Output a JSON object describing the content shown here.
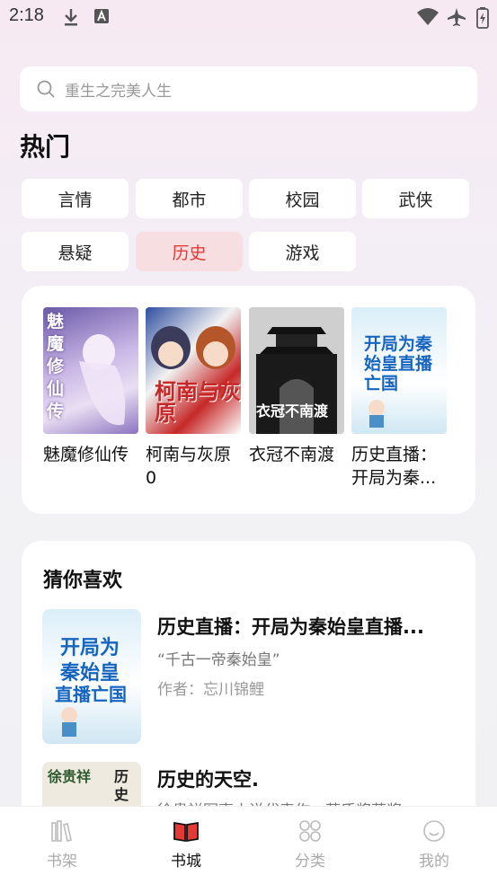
{
  "status": {
    "time": "2:18"
  },
  "search": {
    "placeholder": "重生之完美人生"
  },
  "hot": {
    "title": "热门",
    "tags": [
      "言情",
      "都市",
      "校园",
      "武侠",
      "悬疑",
      "历史",
      "游戏"
    ],
    "active_tag": "历史",
    "books": [
      {
        "title": "魅魔修仙传",
        "cover_text": "魅魔修仙传"
      },
      {
        "title": "柯南与灰原0",
        "cover_text": "柯南与灰原"
      },
      {
        "title": "衣冠不南渡",
        "cover_text": "衣冠不南渡"
      },
      {
        "title": "历史直播：开局为秦...",
        "cover_text": "开局为秦始皇直播亡国"
      }
    ]
  },
  "guess": {
    "title": "猜你喜欢",
    "items": [
      {
        "title": "历史直播：开局为秦始皇直播...",
        "desc": "“千古一帝秦始皇”",
        "author": "作者：忘川锦鲤"
      },
      {
        "title": "历史的天空.",
        "desc": "徐贵祥军事小说代表作，茅盾奖获奖",
        "author": ""
      }
    ]
  },
  "nav": {
    "items": [
      "书架",
      "书城",
      "分类",
      "我的"
    ],
    "active": "书城"
  },
  "colors": {
    "accent": "#e53935",
    "active_tag_bg": "#f7dfe1"
  }
}
